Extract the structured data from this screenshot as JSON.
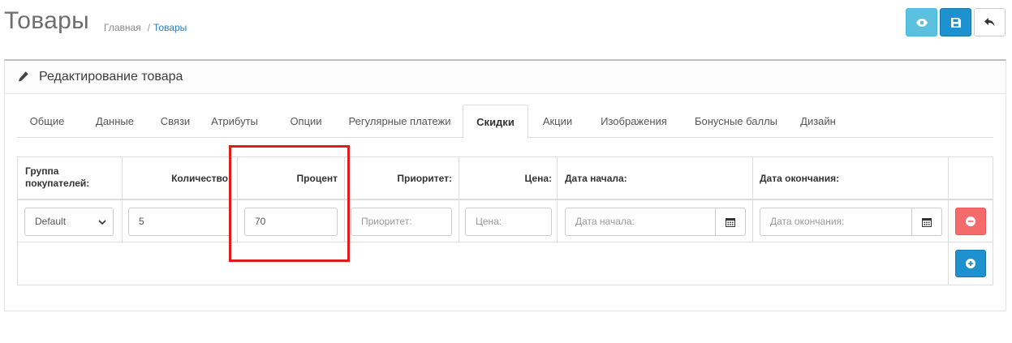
{
  "header": {
    "title": "Товары",
    "breadcrumb": {
      "home": "Главная",
      "separator": "/",
      "current": "Товары"
    }
  },
  "toolbar": {
    "view_icon": "eye-icon",
    "save_icon": "save-icon",
    "back_icon": "reply-icon"
  },
  "panel": {
    "title": "Редактирование товара"
  },
  "tabs": [
    {
      "label": "Общие"
    },
    {
      "label": "Данные"
    },
    {
      "label": "Связи"
    },
    {
      "label": "Атрибуты"
    },
    {
      "label": "Опции"
    },
    {
      "label": "Регулярные платежи"
    },
    {
      "label": "Скидки",
      "active": true
    },
    {
      "label": "Акции"
    },
    {
      "label": "Изображения"
    },
    {
      "label": "Бонусные баллы"
    },
    {
      "label": "Дизайн"
    }
  ],
  "discount_table": {
    "headers": {
      "group_line1": "Группа",
      "group_line2": "покупателей:",
      "quantity": "Количество:",
      "percent": "Процент",
      "priority": "Приоритет:",
      "price": "Цена:",
      "date_start": "Дата начала:",
      "date_end": "Дата окончания:"
    },
    "row": {
      "group": "Default",
      "quantity": "5",
      "percent": "70",
      "priority_placeholder": "Приоритет:",
      "price_placeholder": "Цена:",
      "date_start_placeholder": "Дата начала:",
      "date_end_placeholder": "Дата окончания:"
    }
  },
  "colors": {
    "view_button": "#5bc0de",
    "save_button": "#1e91cf",
    "remove_button": "#f56b6b",
    "add_button": "#1e91cf",
    "highlight": "#e21b1b",
    "breadcrumb_link": "#2b7bbf"
  }
}
